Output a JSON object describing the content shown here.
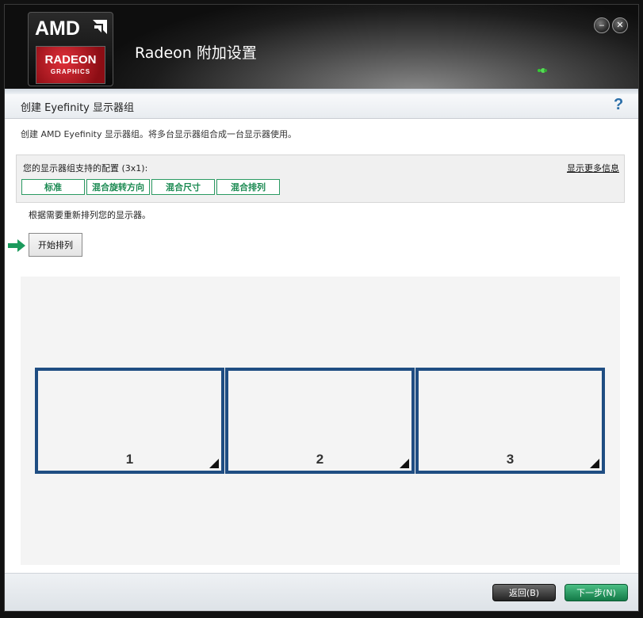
{
  "header": {
    "logo_amd": "AMD",
    "logo_radeon": "RADEON",
    "logo_graphics": "GRAPHICS",
    "app_title": "Radeon 附加设置",
    "min_symbol": "‒",
    "close_symbol": "✕"
  },
  "page": {
    "title": "创建 Eyefinity 显示器组",
    "help_symbol": "?",
    "description": "创建 AMD Eyefinity 显示器组。将多台显示器组合成一台显示器使用。"
  },
  "config": {
    "label": "您的显示器组支持的配置 (3x1):",
    "more_info": "显示更多信息",
    "buttons": [
      "标准",
      "混合旋转方向",
      "混合尺寸",
      "混合排列"
    ]
  },
  "arrange": {
    "instruction": "根据需要重新排列您的显示器。",
    "start_button": "开始排列",
    "monitors": [
      "1",
      "2",
      "3"
    ]
  },
  "footer": {
    "back": "返回(B)",
    "next": "下一步(N)"
  },
  "colors": {
    "accent_green": "#1b8a52",
    "monitor_border": "#1f4d82",
    "help_blue": "#2a6ea8"
  }
}
